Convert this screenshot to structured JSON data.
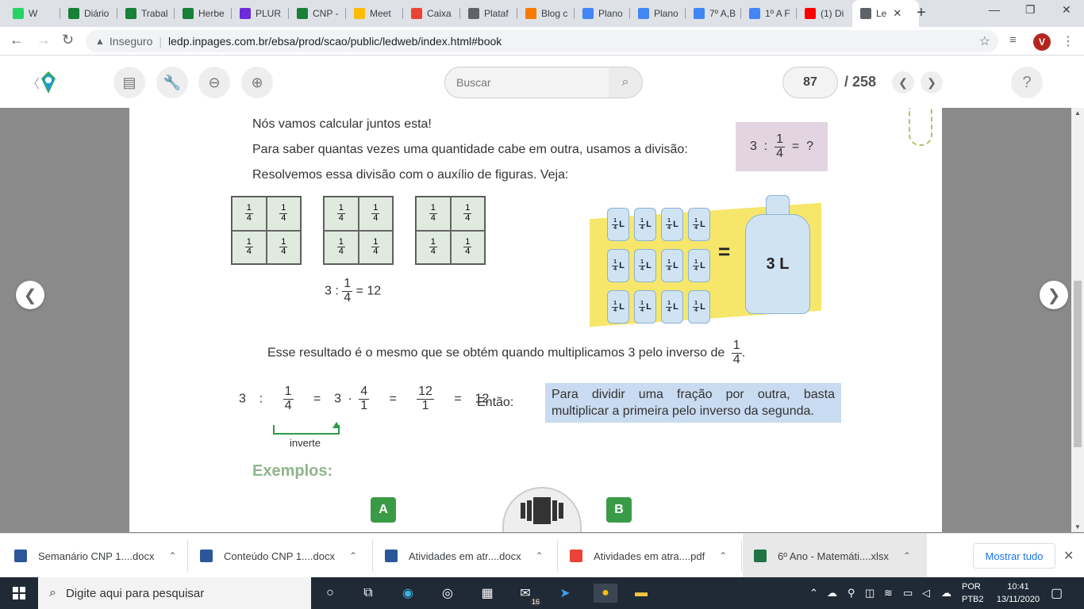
{
  "browser": {
    "tabs": [
      {
        "label": "W",
        "color": "#25d366",
        "icon": "whatsapp-icon"
      },
      {
        "label": "Diário",
        "color": "#188038",
        "icon": "sheets-icon"
      },
      {
        "label": "Trabal",
        "color": "#188038",
        "icon": "sheets-icon"
      },
      {
        "label": "Herbe",
        "color": "#188038",
        "icon": "sheets-icon"
      },
      {
        "label": "PLUR",
        "color": "#6c2bd9",
        "icon": "plurall-icon"
      },
      {
        "label": "CNP -",
        "color": "#188038",
        "icon": "sheets-icon"
      },
      {
        "label": "Meet",
        "color": "#fbbc04",
        "icon": "drive-icon"
      },
      {
        "label": "Caixa",
        "color": "#ea4335",
        "icon": "gmail-icon"
      },
      {
        "label": "Plataf",
        "color": "#5f6368",
        "icon": "globe-icon"
      },
      {
        "label": "Blog c",
        "color": "#f57c00",
        "icon": "blogger-icon"
      },
      {
        "label": "Plano",
        "color": "#4285f4",
        "icon": "docs-icon"
      },
      {
        "label": "Plano",
        "color": "#4285f4",
        "icon": "docs-icon"
      },
      {
        "label": "7º A,B",
        "color": "#4285f4",
        "icon": "docs-icon"
      },
      {
        "label": "1º A F",
        "color": "#4285f4",
        "icon": "docs-icon"
      },
      {
        "label": "(1) Di",
        "color": "#ff0000",
        "icon": "youtube-icon"
      },
      {
        "label": "Le",
        "color": "#5f6368",
        "icon": "globe-icon",
        "active": true
      }
    ],
    "insecure": "Inseguro",
    "url": "ledp.inpages.com.br/ebsa/prod/scao/public/ledweb/index.html#book",
    "avatar": "V"
  },
  "reader": {
    "search_placeholder": "Buscar",
    "current_page": "87",
    "total_pages": "/ 258",
    "help": "?"
  },
  "book": {
    "line1": "Nós vamos calcular juntos esta!",
    "line2": "Para saber quantas vezes uma quantidade cabe em outra, usamos a divisão:",
    "line3": "Resolvemos essa divisão com o auxílio de figuras. Veja:",
    "q": {
      "a": "3",
      "op": ":",
      "num": "1",
      "den": "4",
      "eq": "=",
      "res": "?"
    },
    "cell": {
      "num": "1",
      "den": "4"
    },
    "eq1": {
      "a": "3 :",
      "num": "1",
      "den": "4",
      "res": "= 12"
    },
    "cup_label": "L",
    "eq_sign": "=",
    "bottle_label": "3 L",
    "line4": "Esse resultado é o mesmo que se obtém quando multiplicamos 3 pelo inverso de",
    "line4_frac": {
      "num": "1",
      "den": "4"
    },
    "line4_end": ".",
    "eq2": {
      "a": "3",
      "op1": ":",
      "f1n": "1",
      "f1d": "4",
      "eq1": "=",
      "b": "3 ·",
      "f2n": "4",
      "f2d": "1",
      "eq2": "=",
      "f3n": "12",
      "f3d": "1",
      "eq3": "=",
      "res": "12"
    },
    "entao": "Então:",
    "rule": "Para dividir uma fração por outra, basta multiplicar a primeira pelo inverso da segunda.",
    "inverte": "inverte",
    "exemplos": "Exemplos:",
    "ex_a": "A",
    "ex_b": "B"
  },
  "downloads": [
    {
      "name": "Semanário CNP 1....docx",
      "type": "docx"
    },
    {
      "name": "Conteúdo CNP 1....docx",
      "type": "docx"
    },
    {
      "name": "Atividades em atr....docx",
      "type": "docx"
    },
    {
      "name": "Atividades em atra....pdf",
      "type": "pdf"
    },
    {
      "name": "6º Ano - Matemáti....xlsx",
      "type": "xlsx"
    }
  ],
  "show_all": "Mostrar tudo",
  "taskbar": {
    "search_placeholder": "Digite aqui para pesquisar",
    "lang1": "POR",
    "lang2": "PTB2",
    "time": "10:41",
    "date": "13/11/2020",
    "badge": "16"
  }
}
